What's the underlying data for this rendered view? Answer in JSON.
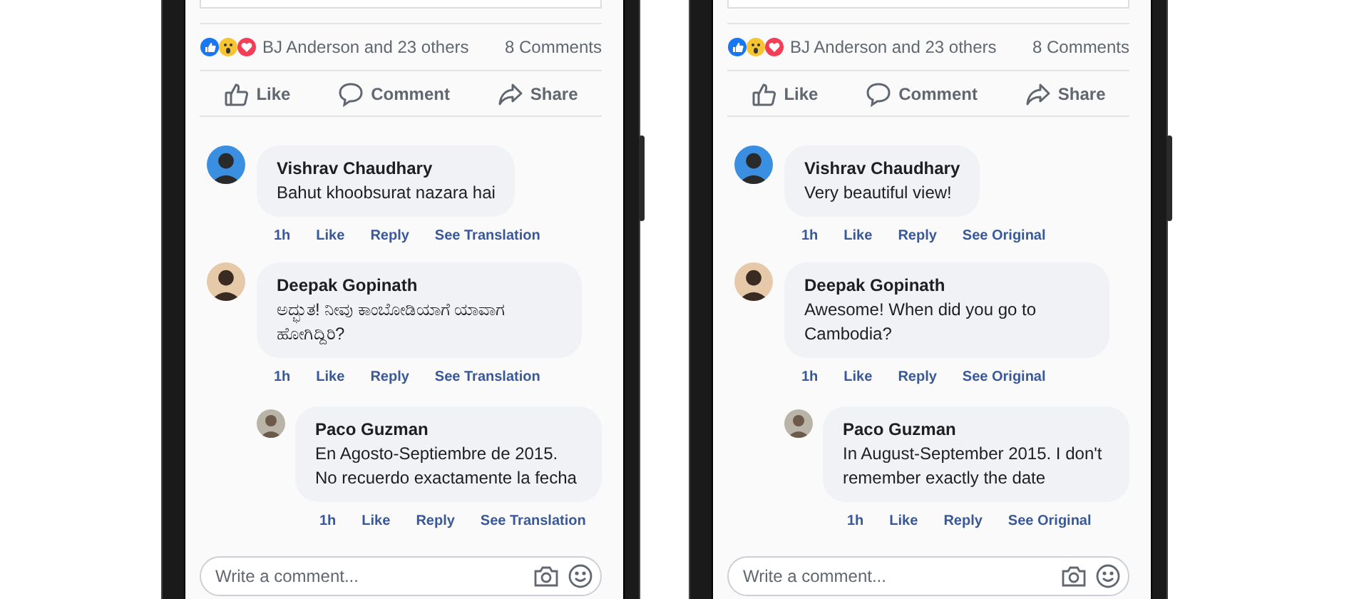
{
  "phones": [
    {
      "reactions_summary": "BJ Anderson and 23 others",
      "comment_count": "8 Comments",
      "actions": [
        {
          "kind": "like",
          "label": "Like"
        },
        {
          "kind": "comment",
          "label": "Comment"
        },
        {
          "kind": "share",
          "label": "Share"
        }
      ],
      "comments": [
        {
          "author": "Vishrav Chaudhary",
          "text": "Bahut khoobsurat nazara hai",
          "time": "1h",
          "like": "Like",
          "reply": "Reply",
          "translation_link": "See Translation"
        },
        {
          "author": "Deepak Gopinath",
          "text": "ಅದ್ಭುತ! ನೀವು ಕಾಂಬೋಡಿಯಾಗೆ ಯಾವಾಗ ಹೋಗಿದ್ದಿರಿ?",
          "time": "1h",
          "like": "Like",
          "reply": "Reply",
          "translation_link": "See Translation",
          "children": [
            {
              "author": "Paco Guzman",
              "text": "En Agosto-Septiembre de 2015. No recuerdo exactamente la fecha",
              "time": "1h",
              "like": "Like",
              "reply": "Reply",
              "translation_link": "See Translation"
            }
          ]
        }
      ],
      "comment_input": {
        "placeholder": "Write a comment..."
      }
    },
    {
      "reactions_summary": "BJ Anderson and 23 others",
      "comment_count": "8 Comments",
      "actions": [
        {
          "kind": "like",
          "label": "Like"
        },
        {
          "kind": "comment",
          "label": "Comment"
        },
        {
          "kind": "share",
          "label": "Share"
        }
      ],
      "comments": [
        {
          "author": "Vishrav Chaudhary",
          "text": "Very beautiful view!",
          "time": "1h",
          "like": "Like",
          "reply": "Reply",
          "translation_link": "See Original"
        },
        {
          "author": "Deepak Gopinath",
          "text": "Awesome! When did you go to Cambodia?",
          "time": "1h",
          "like": "Like",
          "reply": "Reply",
          "translation_link": "See Original",
          "children": [
            {
              "author": "Paco Guzman",
              "text": "In August-September 2015. I don't remember exactly the date",
              "time": "1h",
              "like": "Like",
              "reply": "Reply",
              "translation_link": "See Original"
            }
          ]
        }
      ],
      "comment_input": {
        "placeholder": "Write a comment..."
      }
    }
  ]
}
